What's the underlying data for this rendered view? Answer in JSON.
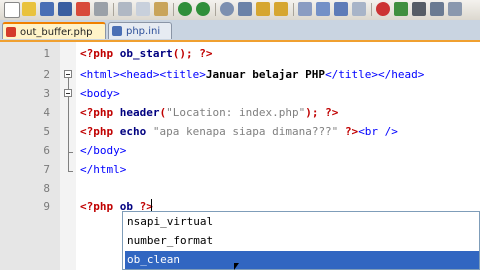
{
  "toolbar": {
    "icons": [
      "new-file-icon",
      "open-folder-icon",
      "save-icon",
      "save-all-icon",
      "close-file-icon",
      "print-icon",
      "cut-icon",
      "copy-icon",
      "paste-icon",
      "undo-icon",
      "redo-icon",
      "find-icon",
      "replace-icon",
      "zoom-in-icon",
      "zoom-out-icon",
      "sync-scroll-icon",
      "word-wrap-icon",
      "show-symbols-icon",
      "indent-guide-icon",
      "macro-record-icon",
      "macro-play-icon"
    ]
  },
  "tabs": [
    {
      "label": "out_buffer.php",
      "active": true
    },
    {
      "label": "php.ini",
      "active": false
    }
  ],
  "editor": {
    "line_numbers": [
      "1",
      "2",
      "3",
      "4",
      "5",
      "6",
      "7",
      "8",
      "9"
    ],
    "lines": {
      "l1": {
        "open": "<?php",
        "fn": "ob_start",
        "rest": "();",
        "close": "?>"
      },
      "l2": {
        "t1": "<html><head><title>",
        "text": "Januar belajar PHP",
        "t2": "</title></head>"
      },
      "l3": {
        "t1": "<body>"
      },
      "l4": {
        "open": "<?php",
        "fn": "header",
        "p1": "(",
        "str": "\"Location: index.php\"",
        "p2": ");",
        "close": "?>"
      },
      "l5": {
        "open": "<?php",
        "fn": "echo",
        "str": "\"apa kenapa siapa dimana???\"",
        "close": "?>",
        "tag": "<br />"
      },
      "l6": {
        "t1": "</body>"
      },
      "l7": {
        "t1": "</html>"
      },
      "l9": {
        "open": "<?php",
        "fn": "ob",
        "close": "?>"
      }
    }
  },
  "autocomplete": {
    "items": [
      "nsapi_virtual",
      "number_format",
      "ob_clean"
    ],
    "selected": "ob_clean"
  }
}
